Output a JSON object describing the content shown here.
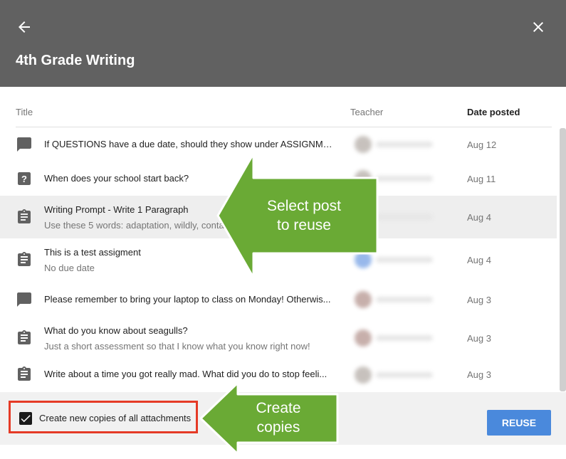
{
  "header": {
    "title": "4th Grade Writing",
    "back_icon": "arrow-back-icon",
    "close_icon": "close-icon"
  },
  "columns": {
    "title": "Title",
    "teacher": "Teacher",
    "date": "Date posted"
  },
  "posts": [
    {
      "icon": "question-stream-icon",
      "title": "If QUESTIONS have a due date, should they show under ASSIGNME...",
      "subtitle": "",
      "date": "Aug 12"
    },
    {
      "icon": "question-icon",
      "title": "When does your school start back?",
      "subtitle": "",
      "date": "Aug 11"
    },
    {
      "icon": "assignment-icon",
      "title": "Writing Prompt - Write 1 Paragraph",
      "subtitle": "Use these 5 words: adaptation, wildly, conta",
      "date": "Aug 4",
      "selected": true
    },
    {
      "icon": "assignment-icon",
      "title": "This is a test assigment",
      "subtitle": "No due date",
      "date": "Aug 4"
    },
    {
      "icon": "announcement-icon",
      "title": "Please remember to bring your laptop to class on Monday! Otherwis...",
      "subtitle": "",
      "date": "Aug 3"
    },
    {
      "icon": "assignment-icon",
      "title": "What do you know about seagulls?",
      "subtitle": "Just a short assessment so that I know what you know right now!",
      "date": "Aug 3"
    },
    {
      "icon": "assignment-icon",
      "title": "Write about a time you got really mad. What did you do to stop feeli...",
      "subtitle": "",
      "date": "Aug 3"
    }
  ],
  "footer": {
    "checkbox_label": "Create new copies of all attachments",
    "checkbox_checked": true,
    "reuse_label": "REUSE"
  },
  "callouts": {
    "select_post_line1": "Select post",
    "select_post_line2": "to reuse",
    "create_copies_line1": "Create",
    "create_copies_line2": "copies"
  },
  "colors": {
    "header": "#616161",
    "accent": "#4a89dc",
    "callout_green": "#6aaa35",
    "highlight_red": "#e53a26"
  }
}
